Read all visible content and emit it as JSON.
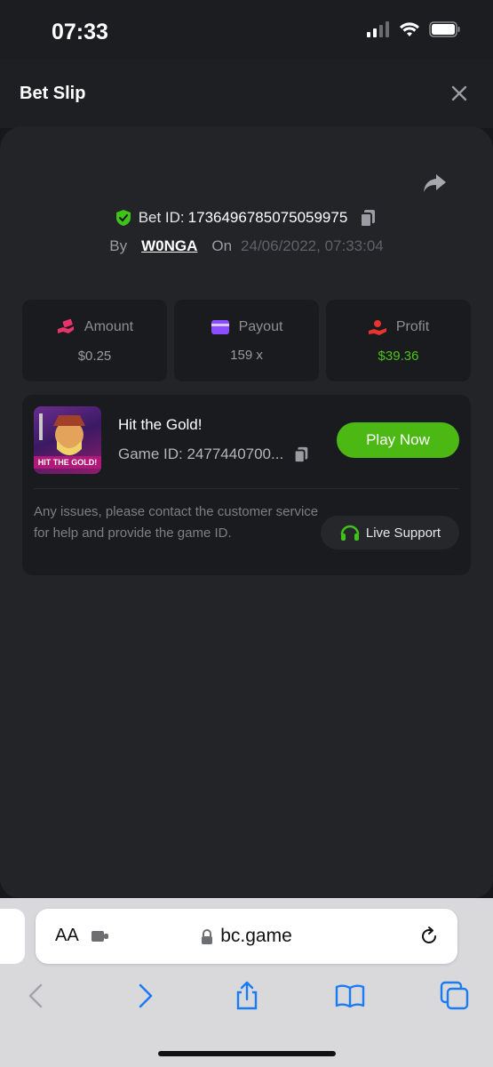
{
  "status": {
    "time": "07:33"
  },
  "header": {
    "title": "Bet Slip"
  },
  "bet": {
    "id_label": "Bet ID:",
    "id_value": "1736496785075059975",
    "by_label": "By",
    "username": "W0NGA",
    "on_label": "On",
    "datetime": "24/06/2022, 07:33:04"
  },
  "stats": {
    "amount": {
      "label": "Amount",
      "value": "$0.25"
    },
    "payout": {
      "label": "Payout",
      "value": "159 x"
    },
    "profit": {
      "label": "Profit",
      "value": "$39.36"
    }
  },
  "game": {
    "title": "Hit the Gold!",
    "thumb_text": "HIT THE GOLD!",
    "id_text": "Game ID: 2477440700...",
    "play_label": "Play Now",
    "help": "Any issues, please contact the customer service for help and provide the game ID.",
    "support_label": "Live Support"
  },
  "browser": {
    "aa_label": "AA",
    "url": "bc.game"
  },
  "colors": {
    "accent_green": "#4cb814",
    "profit_green": "#4cc21a",
    "amount_icon": "#e8336b",
    "payout_icon": "#8a4dff",
    "profit_icon": "#e8332f"
  }
}
